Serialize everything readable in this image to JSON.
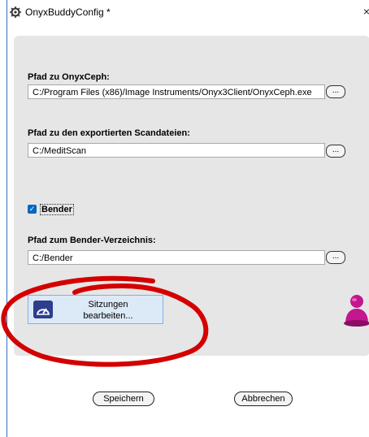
{
  "window": {
    "title": "OnyxBuddyConfig *",
    "close_glyph": "×"
  },
  "onyxceph": {
    "label": "Pfad zu OnyxCeph:",
    "value": "C:/Program Files (x86)/Image Instruments/Onyx3Client/OnyxCeph.exe",
    "browse_label": "..."
  },
  "scan": {
    "label": "Pfad zu den exportierten Scandateien:",
    "value": "C:/MeditScan",
    "browse_label": "..."
  },
  "bender": {
    "checkbox_label": "Bender",
    "checked": true,
    "label": "Pfad zum Bender-Verzeichnis:",
    "value": "C:/Bender",
    "browse_label": "..."
  },
  "sessions": {
    "line1": "Sitzungen",
    "line2": "bearbeiten..."
  },
  "footer": {
    "save_label": "Speichern",
    "cancel_label": "Abbrechen"
  },
  "colors": {
    "accent": "#0067c0",
    "pawn": "#c4168f",
    "annotation": "#d40000",
    "panel": "#e6e6e6"
  }
}
